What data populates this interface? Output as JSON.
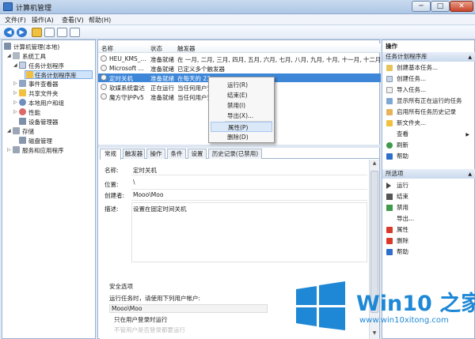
{
  "window": {
    "title": "计算机管理",
    "min": "─",
    "max": "□",
    "close": "✕"
  },
  "menu": [
    "文件(F)",
    "操作(A)",
    "查看(V)",
    "帮助(H)"
  ],
  "tree": {
    "items": [
      "计算机管理(本地)",
      "系统工具",
      "任务计划程序",
      "任务计划程序库",
      "事件查看器",
      "共享文件夹",
      "本地用户和组",
      "性能",
      "设备管理器",
      "存储",
      "磁盘管理",
      "服务和应用程序"
    ]
  },
  "list": {
    "headers": [
      "名称",
      "状态",
      "触发器"
    ],
    "rows": [
      [
        "HEU_KMS_...",
        "准备就绪",
        "在 一月, 二月, 三月, 四月, 五月, 六月, 七月, 八月, 九月, 十月, 十一月, 十二月 的"
      ],
      [
        "Microsoft ...",
        "准备就绪",
        "已定义多个触发器"
      ],
      [
        "定时关机",
        "准备就绪",
        "在每天的 23"
      ],
      [
        "软媒系统雷达",
        "正在运行",
        "当任何用户登"
      ],
      [
        "魔方守护Pv5",
        "准备就绪",
        "当任何用户登"
      ]
    ]
  },
  "context_menu": [
    "运行(R)",
    "结束(E)",
    "禁用(I)",
    "导出(X)...",
    "属性(P)",
    "删除(D)"
  ],
  "tabs": [
    "常规",
    "触发器",
    "操作",
    "条件",
    "设置",
    "历史记录(已禁用)"
  ],
  "props": {
    "name_label": "名称:",
    "name_value": "定时关机",
    "location_label": "位置:",
    "location_value": "\\",
    "author_label": "创建者:",
    "author_value": "Mooo\\Moo",
    "desc_label": "描述:",
    "desc_value": "设置在固定时间关机",
    "security_title": "安全选项",
    "security_text": "运行任务时，请使用下列用户帐户:",
    "account": "Mooo\\Moo",
    "opt1": "只在用户登录时运行",
    "opt2": "不管用户是否登录都要运行"
  },
  "actions": {
    "header": "操作",
    "group1": "任务计划程序库",
    "items1": [
      "创建基本任务...",
      "创建任务...",
      "导入任务...",
      "显示所有正在运行的任务",
      "启用所有任务历史记录",
      "新文件夹...",
      "查看",
      "刷新",
      "帮助"
    ],
    "group2": "所选项",
    "items2": [
      "运行",
      "结束",
      "禁用",
      "导出...",
      "属性",
      "删除",
      "帮助"
    ]
  },
  "watermark": {
    "brand": "Win10 之家",
    "url": "www.win10xitong.com"
  }
}
